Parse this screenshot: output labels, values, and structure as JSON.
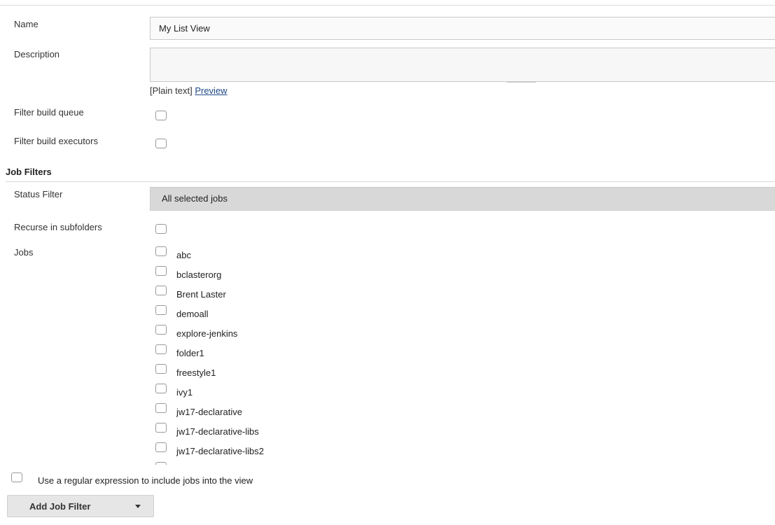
{
  "form": {
    "name_label": "Name",
    "name_value": "My List View",
    "description_label": "Description",
    "description_value": "",
    "plain_text_prefix": "[Plain text]",
    "preview_link": "Preview",
    "filter_queue_label": "Filter build queue",
    "filter_executors_label": "Filter build executors"
  },
  "job_filters": {
    "header": "Job Filters",
    "status_filter_label": "Status Filter",
    "status_filter_value": "All selected jobs",
    "recurse_label": "Recurse in subfolders",
    "jobs_label": "Jobs",
    "jobs": [
      "abc",
      "bclasterorg",
      "Brent Laster",
      "demoall",
      "explore-jenkins",
      "folder1",
      "freestyle1",
      "ivy1",
      "jw17-declarative",
      "jw17-declarative-libs",
      "jw17-declarative-libs2",
      ""
    ],
    "regex_label": "Use a regular expression to include jobs into the view",
    "add_filter_button": "Add Job Filter"
  },
  "icons": {
    "add_filter_dropdown": "caret-down-icon",
    "checkbox": "checkbox-icon"
  }
}
